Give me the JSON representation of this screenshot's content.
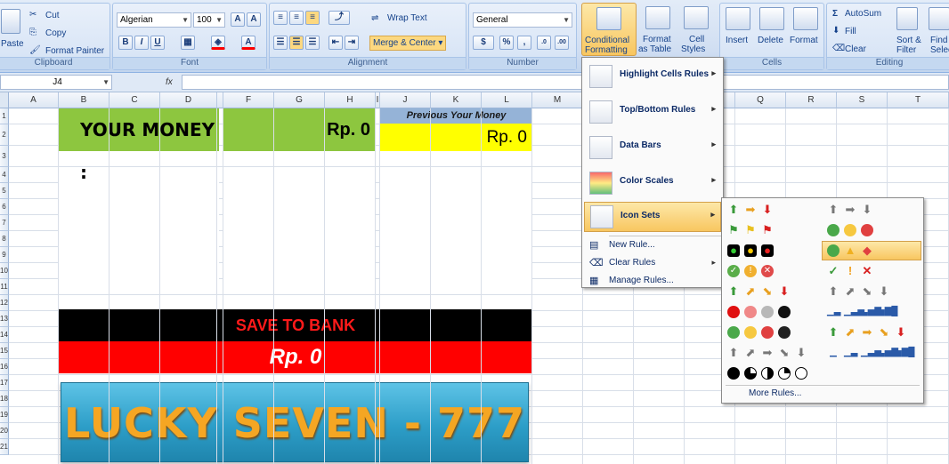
{
  "clipboard": {
    "paste": "Paste",
    "cut": "Cut",
    "copy": "Copy",
    "painter": "Format Painter",
    "label": "Clipboard"
  },
  "font": {
    "name": "Algerian",
    "size": "100",
    "label": "Font"
  },
  "alignment": {
    "wrap": "Wrap Text",
    "merge": "Merge & Center",
    "label": "Alignment"
  },
  "number": {
    "format": "General",
    "percent": "%",
    "comma": ",",
    "label": "Number"
  },
  "styles": {
    "cond1": "Conditional",
    "cond2": "Formatting",
    "fat1": "Format",
    "fat2": "as Table",
    "cs1": "Cell",
    "cs2": "Styles"
  },
  "cells": {
    "insert": "Insert",
    "delete": "Delete",
    "format": "Format",
    "label": "Cells"
  },
  "editing": {
    "autosum": "AutoSum",
    "fill": "Fill",
    "clear": "Clear",
    "sort1": "Sort &",
    "sort2": "Filter",
    "find1": "Find",
    "find2": "Selec",
    "label": "Editing"
  },
  "formula": {
    "cell": "J4",
    "fx": "fx"
  },
  "columns": [
    "A",
    "B",
    "C",
    "D",
    "",
    "F",
    "G",
    "H",
    "I",
    "J",
    "K",
    "L",
    "M",
    "N",
    "O",
    "P",
    "Q",
    "R",
    "S",
    "T"
  ],
  "rows": [
    "1",
    "2",
    "3",
    "4",
    "5",
    "6",
    "7",
    "8",
    "9",
    "10",
    "11",
    "12",
    "13",
    "14",
    "15",
    "16",
    "17",
    "18",
    "19",
    "20",
    "21"
  ],
  "sheet": {
    "your_money": "YOUR MONEY :",
    "money_value": "Rp. 0",
    "prev_label": "Previous Your Money",
    "prev_value": "Rp. 0",
    "save_label": "SAVE TO BANK",
    "save_value": "Rp. 0",
    "banner": "LUCKY SEVEN - 777"
  },
  "menu": {
    "highlight": "Highlight Cells Rules",
    "topbottom": "Top/Bottom Rules",
    "databars": "Data Bars",
    "colorscales": "Color Scales",
    "iconsets": "Icon Sets",
    "newrule": "New Rule...",
    "clearrules": "Clear Rules",
    "manage": "Manage Rules..."
  },
  "submenu": {
    "more": "More Rules..."
  },
  "colors": {
    "green": "#8dc63f",
    "yellow": "#ffff00",
    "blue_hdr": "#95b3d7",
    "black": "#000000",
    "red": "#ff0000",
    "banner_bg": "#2d9ec8",
    "banner_text": "#f5a623"
  }
}
